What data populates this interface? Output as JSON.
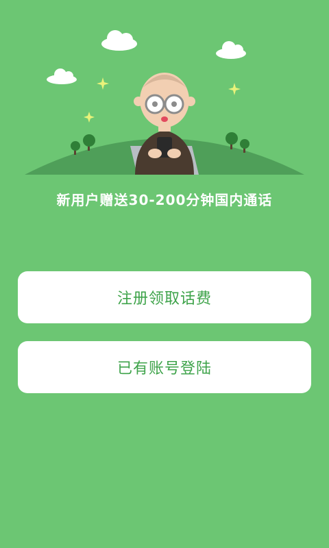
{
  "tagline": "新用户赠送30-200分钟国内通话",
  "buttons": {
    "register_label": "注册领取话费",
    "login_label": "已有账号登陆"
  },
  "colors": {
    "background": "#6cc673",
    "hill": "#4f9f59",
    "button_bg": "#ffffff",
    "button_text": "#3ea34a"
  },
  "icons": [
    "cloud-icon",
    "sparkle-icon",
    "tree-icon",
    "old-man-illustration"
  ]
}
